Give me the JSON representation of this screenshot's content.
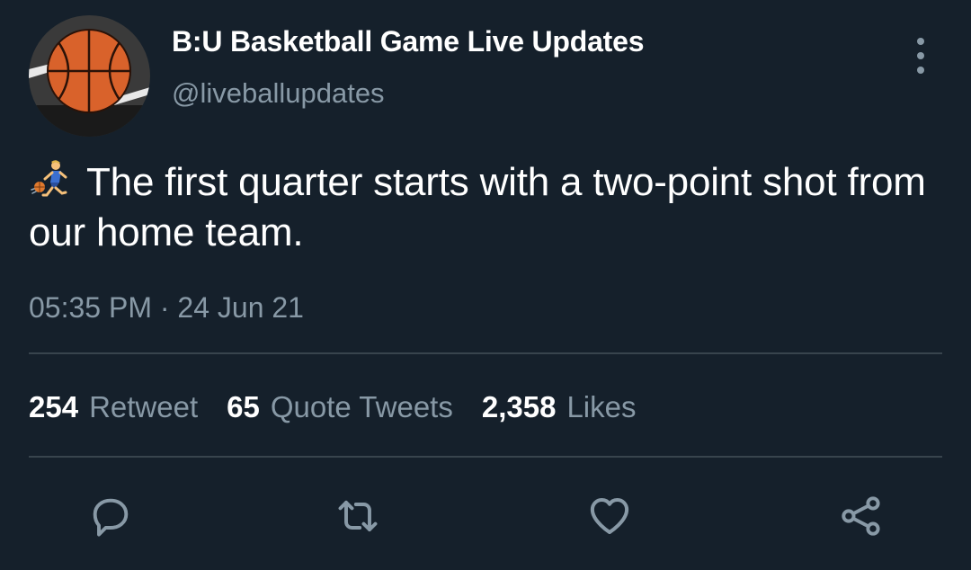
{
  "tweet": {
    "author": {
      "display_name": "B:U Basketball Game Live Updates",
      "handle": "@liveballupdates",
      "avatar_icon": "basketball-icon"
    },
    "text": "The first quarter starts with a two-point shot from our home team.",
    "leading_emoji": "person-bouncing-ball",
    "timestamp": "05:35 PM · 24 Jun 21"
  },
  "stats": {
    "retweets": {
      "count": "254",
      "label": "Retweet"
    },
    "quotes": {
      "count": "65",
      "label": "Quote Tweets"
    },
    "likes": {
      "count": "2,358",
      "label": "Likes"
    }
  },
  "actions": [
    "reply-icon",
    "retweet-icon",
    "like-icon",
    "share-icon"
  ],
  "colors": {
    "background": "#15202b",
    "secondary_text": "#8899a6",
    "divider": "#38444d",
    "primary_text": "#ffffff"
  }
}
